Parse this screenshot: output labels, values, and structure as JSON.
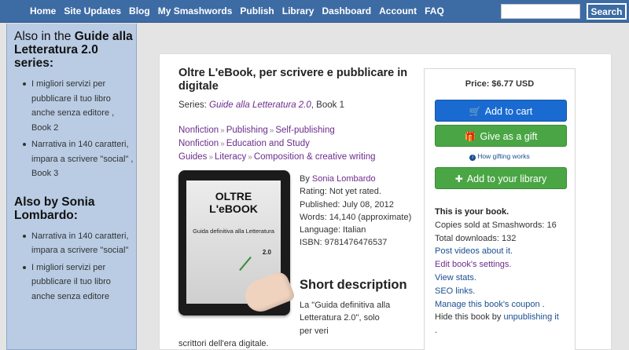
{
  "nav": {
    "links": [
      "Home",
      "Site Updates",
      "Blog",
      "My Smashwords",
      "Publish",
      "Library",
      "Dashboard",
      "Account",
      "FAQ"
    ],
    "search_button": "Search",
    "search_value": ""
  },
  "sidebar": {
    "series_heading_prefix": "Also in the ",
    "series_heading_name": "Guide alla Letteratura 2.0",
    "series_heading_suffix": " series:",
    "series_items": [
      "I migliori servizi per pubblicare il tuo libro anche senza editore , Book 2",
      "Narrativa in 140 caratteri, impara a scrivere \"social\" , Book 3"
    ],
    "author_heading_prefix": "Also by ",
    "author_heading_name": "Sonia Lombardo",
    "author_heading_suffix": ":",
    "author_items": [
      "Narrativa in 140 caratteri, impara a scrivere \"social\"",
      "I migliori servizi per pubblicare il tuo libro anche senza editore"
    ]
  },
  "book": {
    "title": "Oltre L'eBook, per scrivere e pubblicare in digitale",
    "series_label": "Series: ",
    "series_name": "Guide alla Letteratura 2.0",
    "series_suffix": ", Book 1",
    "categories": [
      [
        "Nonfiction",
        "Publishing",
        "Self-publishing"
      ],
      [
        "Nonfiction",
        "Education and Study"
      ],
      [
        "Guides",
        "Literacy",
        "Composition & creative writing"
      ]
    ],
    "cover": {
      "title_line1": "OLTRE",
      "title_line2": "L'eBOOK",
      "subtitle": "Guida definitiva alla Letteratura",
      "version": "2.0"
    },
    "by_label": "By ",
    "author": "Sonia Lombardo",
    "rating": "Rating: Not yet rated.",
    "published": "Published: July 08, 2012",
    "words": "Words: 14,140 (approximate)",
    "language": "Language: Italian",
    "isbn": "ISBN: 9781476476537",
    "short_heading": "Short description",
    "short_line1": "La \"Guida definitiva alla",
    "short_line2": "Letteratura 2.0\", solo per veri",
    "short_line3": "scrittori dell'era digitale."
  },
  "buybox": {
    "price": "Price: $6.77 USD",
    "add_to_cart": "Add to cart",
    "give_gift": "Give as a gift",
    "how_gifting": "How gifting works",
    "add_library": "Add to your library",
    "owner_heading": "This is your book.",
    "copies_sold": "Copies sold at Smashwords: 16",
    "total_downloads": "Total downloads: 132",
    "post_videos": "Post videos about it.",
    "edit_settings": "Edit book's settings.",
    "view_stats": "View stats.",
    "seo_links": "SEO links.",
    "manage_coupon": "Manage this book's coupon",
    "manage_coupon_suffix": " .",
    "hide_prefix": "Hide this book by ",
    "hide_link": "unpublishing it",
    "hide_suffix": "."
  },
  "colors": {
    "nav_bg": "#3d6ba4",
    "sidebar_bg": "#b9cce4",
    "link_purple": "#6d2c8c",
    "link_blue": "#1a4f91",
    "cart_blue": "#1a6bd1",
    "gift_green": "#4aa644"
  }
}
